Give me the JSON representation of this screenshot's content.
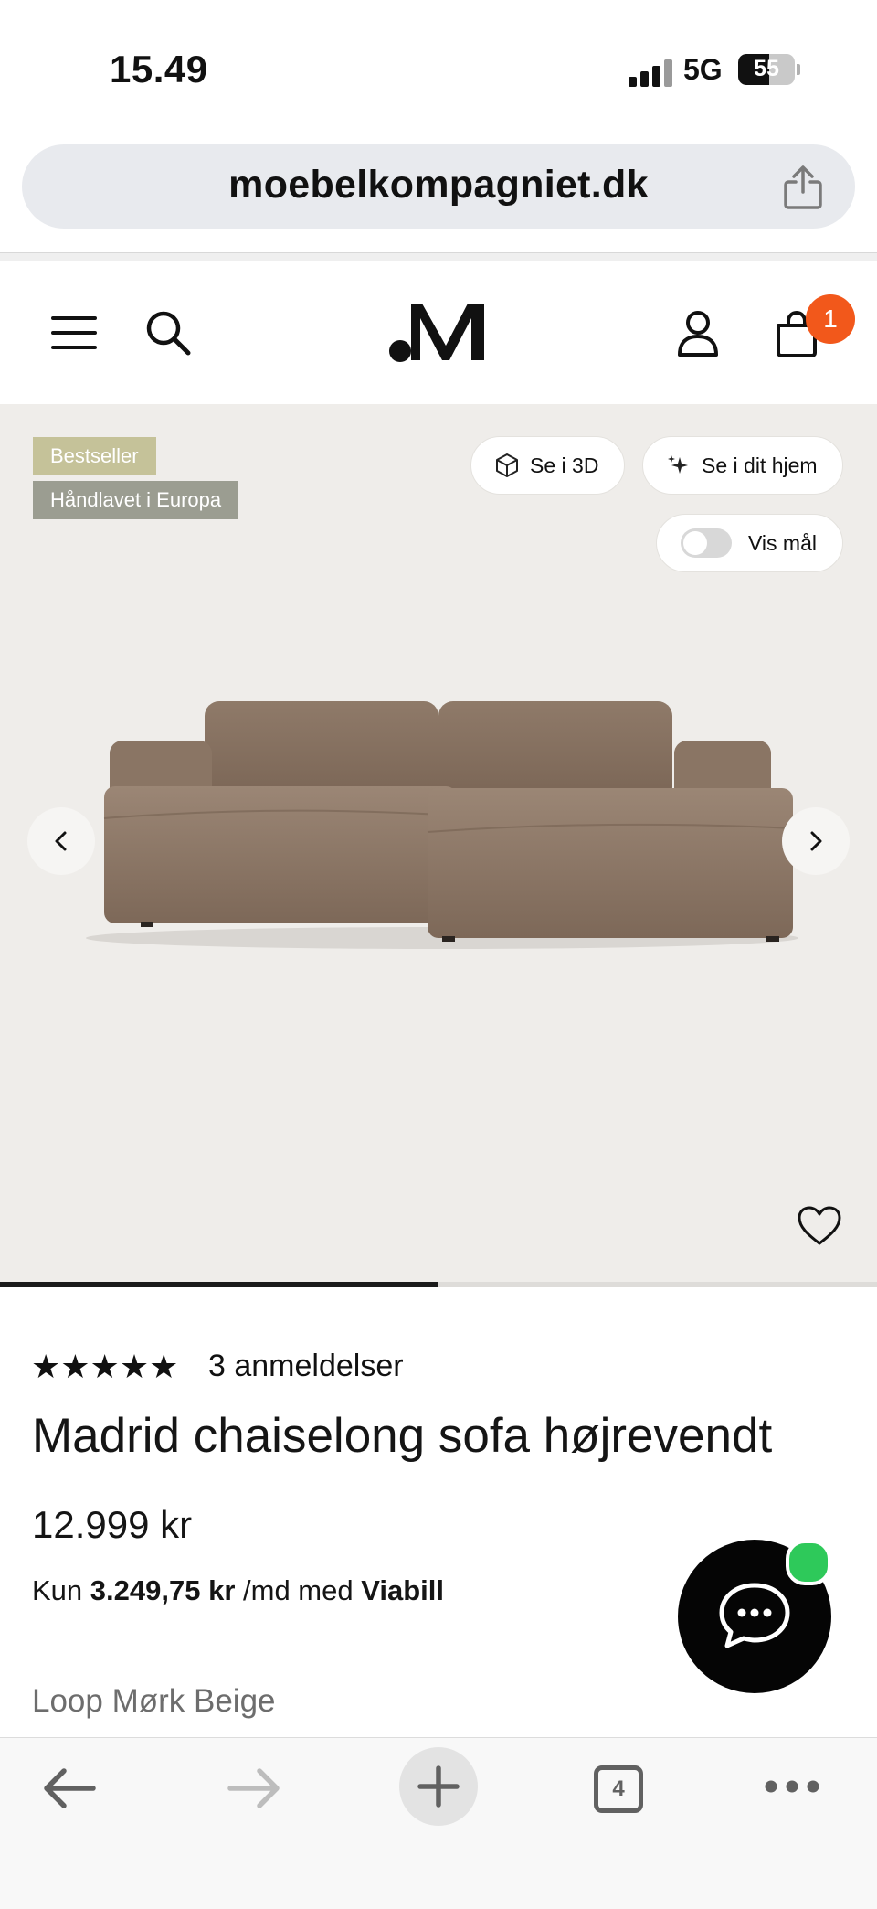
{
  "status_bar": {
    "time": "15.49",
    "network": "5G",
    "battery_level": "55",
    "battery_fraction": 0.55
  },
  "browser": {
    "url": "moebelkompagniet.dk",
    "open_tabs": "4"
  },
  "header": {
    "cart_count": "1",
    "logo_icon": "M-monogram-logo"
  },
  "hero": {
    "badges": [
      "Bestseller",
      "Håndlavet i Europa"
    ],
    "view_3d_label": "Se i 3D",
    "view_home_label": "Se i dit hjem",
    "show_dimensions_label": "Vis mål",
    "show_dimensions_on": false,
    "gallery_progress": 0.5
  },
  "product": {
    "stars": "★★★★★",
    "rating": 5,
    "reviews": "3 anmeldelser",
    "title": "Madrid chaiselong sofa højrevendt",
    "price": "12.999 kr",
    "installment_prefix": "Kun",
    "installment_amount": "3.249,75 kr",
    "installment_mid": "/md med",
    "installment_provider": "Viabill",
    "variant": "Loop Mørk Beige"
  },
  "colors": {
    "cart_badge": "#f2581b",
    "online_dot": "#2ec95a",
    "badge_bestseller": "#c5c299",
    "badge_handmade": "#9b9d91",
    "hero_background": "#efedea",
    "sofa_fabric": "#8c7665"
  }
}
